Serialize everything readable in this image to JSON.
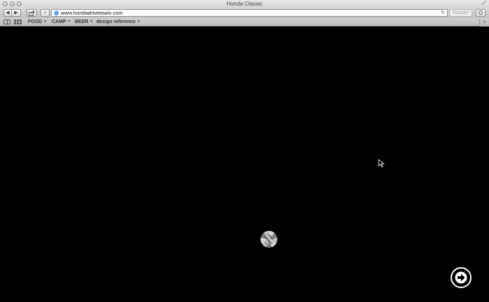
{
  "window": {
    "title": "Honda Classic"
  },
  "toolbar": {
    "back_label": "◀",
    "forward_label": "▶",
    "share_icon": "share-icon",
    "add_label": "+",
    "url": "www.hondadrivetowin.com",
    "reader_label": "Reader"
  },
  "bookmarks": {
    "items": [
      {
        "label": "FOOD"
      },
      {
        "label": "CAMP"
      },
      {
        "label": "BEER"
      },
      {
        "label": "design reference"
      }
    ]
  },
  "content": {
    "background": "#000000",
    "loader_icon": "loading-spinner-icon",
    "next_icon": "next-arrow-icon"
  }
}
